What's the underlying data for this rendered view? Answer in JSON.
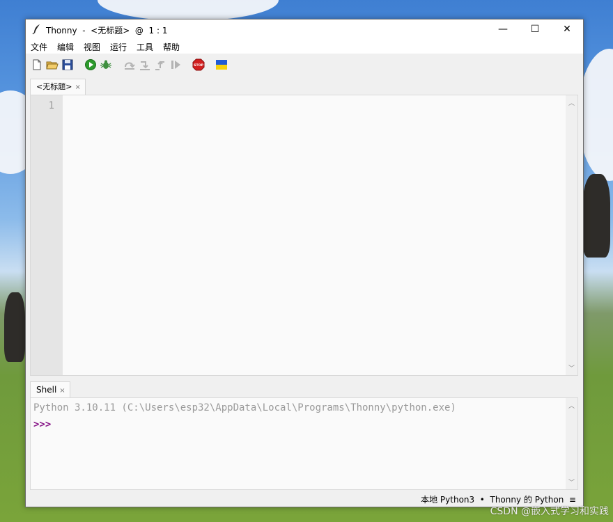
{
  "window": {
    "title": "Thonny  -  <无标题>  @  1 : 1",
    "minimize_glyph": "—",
    "maximize_glyph": "☐",
    "close_glyph": "✕"
  },
  "menu": [
    "文件",
    "编辑",
    "视图",
    "运行",
    "工具",
    "帮助"
  ],
  "toolbar": {
    "icons": [
      "new-file-icon",
      "open-file-icon",
      "save-icon",
      "run-icon",
      "debug-icon",
      "step-over-icon",
      "step-into-icon",
      "step-out-icon",
      "resume-icon",
      "stop-icon",
      "ukraine-flag-icon"
    ],
    "stop_label": "STOP"
  },
  "editor": {
    "tab_label": "<无标题>",
    "tab_close": "×",
    "line_numbers": [
      "1"
    ],
    "content": ""
  },
  "shell": {
    "tab_label": "Shell",
    "tab_close": "×",
    "banner": "Python 3.10.11 (C:\\Users\\esp32\\AppData\\Local\\Programs\\Thonny\\python.exe)",
    "prompt": ">>>"
  },
  "statusbar": {
    "text": "本地 Python3  •  Thonny 的 Python  ≡"
  },
  "watermark": "CSDN @嵌入式学习和实践",
  "colors": {
    "prompt": "#8a1b8a",
    "banner": "#9a9a9a",
    "line_number": "#9a9a9a",
    "stop": "#d21f1f",
    "run": "#2c9a2c",
    "flag_blue": "#1f5bd6",
    "flag_yellow": "#f5d10c"
  }
}
